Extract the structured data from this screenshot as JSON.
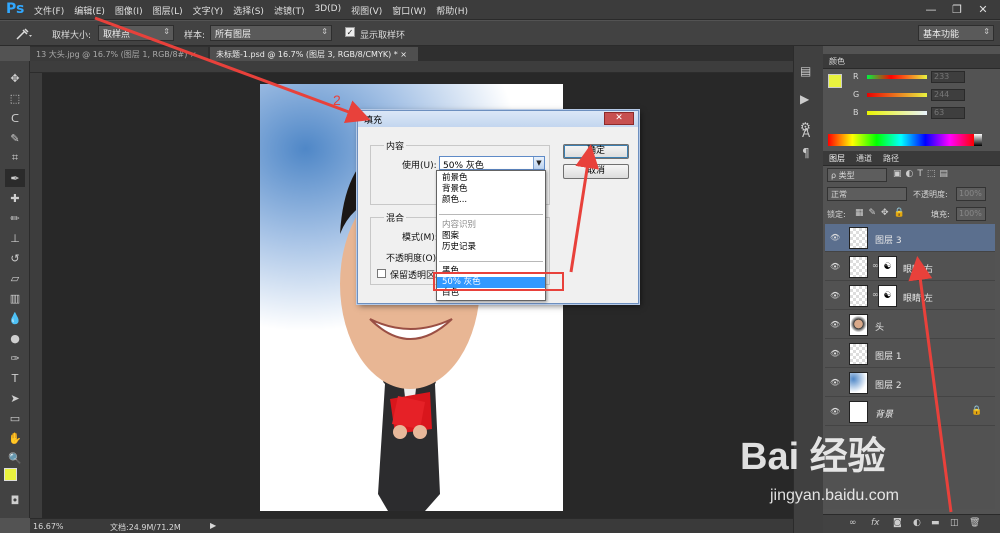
{
  "app": {
    "logo": "Ps"
  },
  "menu": [
    "文件(F)",
    "编辑(E)",
    "图像(I)",
    "图层(L)",
    "文字(Y)",
    "选择(S)",
    "滤镜(T)",
    "3D(D)",
    "视图(V)",
    "窗口(W)",
    "帮助(H)"
  ],
  "window_controls": [
    "—",
    "❐",
    "✕"
  ],
  "options": {
    "sample_size_label": "取样大小:",
    "sample_size_value": "取样点",
    "sample_label": "样本:",
    "sample_value": "所有图层",
    "show_ring_label": "显示取样环",
    "workspace": "基本功能"
  },
  "tabs": [
    {
      "label": "13 大头.jpg @ 16.7% (图层 1, RGB/8#) ×",
      "active": false
    },
    {
      "label": "未标题-1.psd @ 16.7% (图层 3, RGB/8/CMYK) * ×",
      "active": true
    }
  ],
  "status": {
    "zoom": "16.67%",
    "doc": "文档:24.9M/71.2M"
  },
  "color_panel": {
    "title": "颜色",
    "channels": [
      {
        "label": "R",
        "value": "233",
        "color": "#e2e832"
      },
      {
        "label": "G",
        "value": "244",
        "color": "#e9e93a"
      },
      {
        "label": "B",
        "value": "63",
        "color": "#e8e840"
      }
    ],
    "foreground": "#e9f33f"
  },
  "layers_panel": {
    "tabs": [
      "图层",
      "通道",
      "路径"
    ],
    "filter": "ρ 类型",
    "blend": "正常",
    "opacity_label": "不透明度:",
    "opacity": "100%",
    "lock_label": "锁定:",
    "fill_label": "填充:",
    "fill": "100%",
    "layers": [
      {
        "name": "图层 3",
        "selected": true,
        "italic": false
      },
      {
        "name": "眼睛 右",
        "selected": false,
        "italic": false
      },
      {
        "name": "眼睛 左",
        "selected": false,
        "italic": false
      },
      {
        "name": "头",
        "selected": false,
        "italic": false
      },
      {
        "name": "图层 1",
        "selected": false,
        "italic": false
      },
      {
        "name": "图层 2",
        "selected": false,
        "italic": false
      },
      {
        "name": "背景",
        "selected": false,
        "italic": true
      }
    ],
    "bottom_icons": [
      "link-icon",
      "fx-icon",
      "mask-icon",
      "adjustment-icon",
      "group-icon",
      "new-layer-icon",
      "trash-icon"
    ]
  },
  "dialog": {
    "title": "填充",
    "close": "✕",
    "content_group": "内容",
    "use_label": "使用(U):",
    "use_value": "50% 灰色",
    "ok": "确定",
    "cancel": "取消",
    "blend_group": "混合",
    "mode_label": "模式(M):",
    "opacity_label": "不透明度(O):",
    "preserve_label": "保留透明区域",
    "dropdown": {
      "group1": [
        "前景色",
        "背景色",
        "颜色..."
      ],
      "group2": [
        "内容识别",
        "图案",
        "历史记录"
      ],
      "group3": [
        "黑色",
        "50% 灰色",
        "白色"
      ],
      "highlighted": "50% 灰色"
    }
  },
  "annotations": {
    "step2": "2"
  },
  "watermark": {
    "brand": "Bai 经验",
    "url": "jingyan.baidu.com"
  }
}
